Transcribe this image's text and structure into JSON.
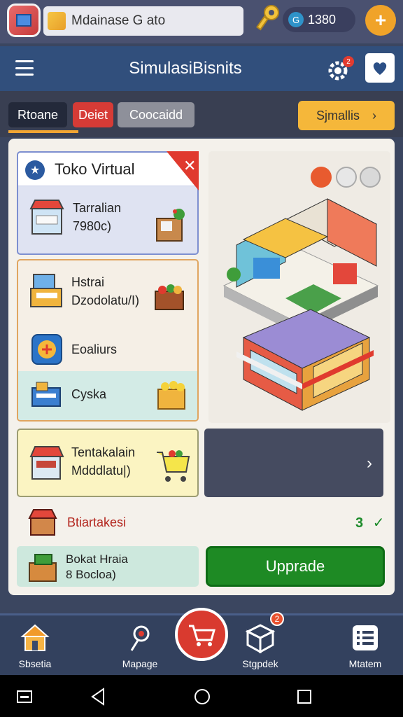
{
  "topbar": {
    "app_title": "Mdainase G ato",
    "coins": "1380",
    "coin_icon_letter": "G",
    "plus_label": "+"
  },
  "header": {
    "title": "SimulasiBisnits",
    "gear_badge": "2"
  },
  "tabs": [
    {
      "label": "Rtoane"
    },
    {
      "label": "Deiet"
    },
    {
      "label": "Coocaidd"
    }
  ],
  "simulate_button": {
    "label": "Sjmallis",
    "chevron": "›"
  },
  "toko_card": {
    "title": "Toko Virtual",
    "close": "✕",
    "item_line1": "Tarralian",
    "item_line2": "7980c)"
  },
  "group_card": {
    "item1_line1": "Hstrai",
    "item1_line2": "Dzodolatu/I)",
    "item2": "Eoaliurs",
    "item3": "Cyska"
  },
  "tentara_card": {
    "line1": "Tentakalain",
    "line2": "Mdddlatu|)"
  },
  "dark_card": {
    "chevron": "›"
  },
  "transaction": {
    "label": "Btiartakesi",
    "count": "3",
    "check": "✓"
  },
  "bekal": {
    "line1": "Bokat Hraia",
    "line2": "8 Bocloa)"
  },
  "upgrade_button": {
    "label": "Upprade"
  },
  "bottom_nav": [
    {
      "label": "Sbsetia"
    },
    {
      "label": "Mapage"
    },
    {
      "label": "Stgpdek",
      "badge": "2"
    },
    {
      "label": "Mtatem"
    }
  ],
  "colors": {
    "accent_orange": "#f5b73a",
    "upgrade_green": "#1e8a24",
    "danger_red": "#d63b36",
    "header_blue": "#314f7c"
  }
}
